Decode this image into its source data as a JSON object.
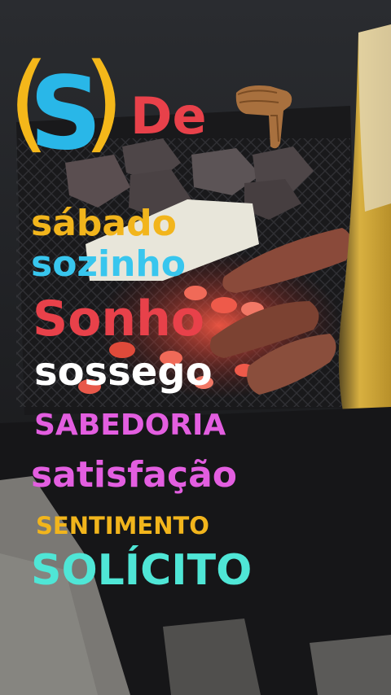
{
  "photo": {
    "description_icon": "grill-photo",
    "colors": {
      "background": "#1c1d20",
      "grill_grate": "#2a2a2c",
      "charcoal": "#4a4446",
      "ember": "#e04a3a",
      "sausage": "#8a4a3a",
      "cheese": "#e8e6da",
      "beer": "#d8b040",
      "concrete": "#7a7874"
    }
  },
  "logo": {
    "paren_left": "(",
    "letter": "S",
    "paren_right": ")",
    "letter_color": "#29b7e8",
    "paren_color": "#f4b71a"
  },
  "heading": {
    "text": "De",
    "color": "#e8414a",
    "icon": "pointing-down-hand-icon"
  },
  "words": [
    {
      "text": "sábado",
      "color": "#f2b51c"
    },
    {
      "text": "sozinho",
      "color": "#38c6ee"
    },
    {
      "text": "Sonho",
      "color": "#e8414a"
    },
    {
      "text": "sossego",
      "color": "#ffffff"
    },
    {
      "text": "SABEDORIA",
      "color": "#e35ee0"
    },
    {
      "text": "satisfação",
      "color": "#e35ee0"
    },
    {
      "text": "SENTIMENTO",
      "color": "#f2b51c"
    },
    {
      "text": "SOLÍCITO",
      "color": "#4fe6d6"
    }
  ]
}
